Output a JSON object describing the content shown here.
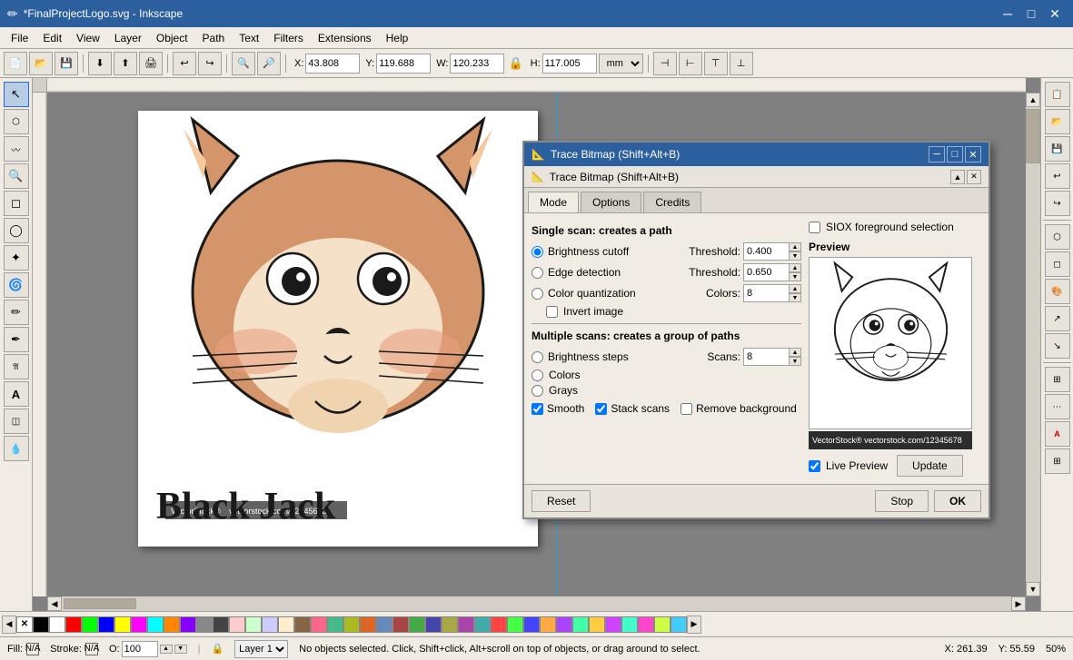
{
  "app": {
    "title": "*FinalProjectLogo.svg - Inkscape",
    "icon": "✏️"
  },
  "titlebar": {
    "minimize": "─",
    "maximize": "□",
    "close": "✕"
  },
  "menu": {
    "items": [
      "File",
      "Edit",
      "View",
      "Layer",
      "Object",
      "Path",
      "Text",
      "Filters",
      "Extensions",
      "Help"
    ]
  },
  "toolbar": {
    "coords": {
      "x_label": "X:",
      "x_value": "43.808",
      "y_label": "Y:",
      "y_value": "119.688",
      "w_label": "W:",
      "w_value": "120.233",
      "h_label": "H:",
      "h_value": "117.005",
      "unit": "mm"
    }
  },
  "left_tools": [
    "↖",
    "⬡",
    "◻",
    "✏",
    "✒",
    "⟳",
    "△",
    "✶",
    "✦",
    "☁",
    "🅰",
    "✎",
    "⬤",
    "◱",
    "✂"
  ],
  "right_tools": [
    "📋",
    "📂",
    "💾",
    "🖨",
    "↩",
    "↪",
    "🔍",
    "🔎",
    "⚙",
    "📐",
    "🎨",
    "🖼",
    "⊞"
  ],
  "dialog": {
    "title": "Trace Bitmap (Shift+Alt+B)",
    "subtitle": "Trace Bitmap (Shift+Alt+B)",
    "tabs": [
      "Mode",
      "Options",
      "Credits"
    ],
    "active_tab": "Mode",
    "single_scan_title": "Single scan: creates a path",
    "radios": [
      {
        "id": "brightness",
        "label": "Brightness cutoff",
        "checked": true
      },
      {
        "id": "edge",
        "label": "Edge detection",
        "checked": false
      },
      {
        "id": "color_quant",
        "label": "Color quantization",
        "checked": false
      }
    ],
    "threshold_label": "Threshold:",
    "threshold_brightness": "0.400",
    "threshold_edge": "0.650",
    "colors_label": "Colors:",
    "colors_value": "8",
    "invert_label": "Invert image",
    "invert_checked": false,
    "multiple_scan_title": "Multiple scans: creates a group of paths",
    "multi_radios": [
      {
        "id": "bright_steps",
        "label": "Brightness steps",
        "checked": false
      },
      {
        "id": "colors_multi",
        "label": "Colors",
        "checked": false
      },
      {
        "id": "grays",
        "label": "Grays",
        "checked": false
      }
    ],
    "scans_label": "Scans:",
    "scans_value": "8",
    "smooth_label": "Smooth",
    "smooth_checked": true,
    "stack_scans_label": "Stack scans",
    "stack_scans_checked": true,
    "remove_bg_label": "Remove background",
    "remove_bg_checked": false,
    "siox_label": "SIOX foreground selection",
    "siox_checked": false,
    "preview_title": "Preview",
    "preview_strip_text": "VectorStock®              vectorstock.com/12345678",
    "live_preview_label": "Live Preview",
    "live_preview_checked": true,
    "update_btn": "Update",
    "reset_btn": "Reset",
    "stop_btn": "Stop",
    "ok_btn": "OK"
  },
  "status": {
    "fill_label": "Fill:",
    "fill_color": "N/A",
    "stroke_label": "Stroke:",
    "stroke_color": "N/A",
    "opacity_label": "O:",
    "opacity_value": "100",
    "layer_label": "Layer 1",
    "message": "No objects selected. Click, Shift+click, Alt+scroll on top of objects, or drag around to select.",
    "x": "X: 261.39",
    "y": "Y: 55.59",
    "zoom": "50%"
  },
  "palette": {
    "colors": [
      "#000000",
      "#ffffff",
      "#ff0000",
      "#00ff00",
      "#0000ff",
      "#ffff00",
      "#ff00ff",
      "#00ffff",
      "#ff8800",
      "#8800ff",
      "#888888",
      "#444444",
      "#ffcccc",
      "#ccffcc",
      "#ccccff",
      "#ffeecc",
      "#886644",
      "#ff6688",
      "#44bb88",
      "#aabb22",
      "#dd6622",
      "#6688bb",
      "#aa4444",
      "#44aa44",
      "#4444aa",
      "#aaaa44",
      "#aa44aa",
      "#44aaaa",
      "#ff4444",
      "#44ff44",
      "#4444ff",
      "#ffaa44",
      "#aa44ff",
      "#44ffaa",
      "#ffcc44",
      "#cc44ff",
      "#44ffcc",
      "#ff44cc",
      "#ccff44",
      "#44ccff"
    ]
  }
}
